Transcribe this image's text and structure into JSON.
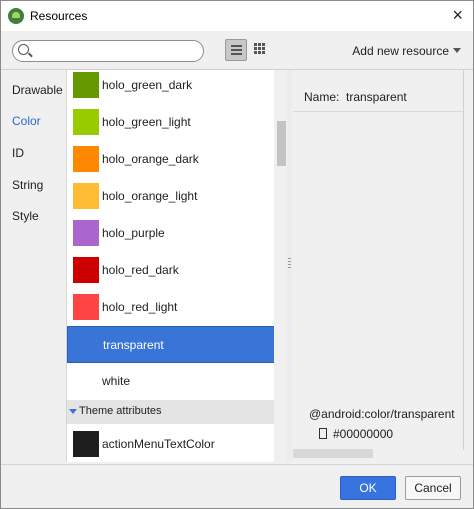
{
  "window": {
    "title": "Resources",
    "close_glyph": "×"
  },
  "search": {
    "value": "",
    "placeholder": ""
  },
  "toolbar": {
    "add_new_label": "Add new resource"
  },
  "left_nav": {
    "items": [
      {
        "label": "Drawable",
        "active": false
      },
      {
        "label": "Color",
        "active": true
      },
      {
        "label": "ID",
        "active": false
      },
      {
        "label": "String",
        "active": false
      },
      {
        "label": "Style",
        "active": false
      }
    ]
  },
  "resources": [
    {
      "label": "holo_green_dark",
      "color": "#669900"
    },
    {
      "label": "holo_green_light",
      "color": "#99cc00"
    },
    {
      "label": "holo_orange_dark",
      "color": "#ff8800"
    },
    {
      "label": "holo_orange_light",
      "color": "#ffbb33"
    },
    {
      "label": "holo_purple",
      "color": "#aa66cc"
    },
    {
      "label": "holo_red_dark",
      "color": "#cc0000"
    },
    {
      "label": "holo_red_light",
      "color": "#ff4444"
    },
    {
      "label": "transparent",
      "color": "#00000000",
      "selected": true
    },
    {
      "label": "white",
      "color": "#ffffff"
    }
  ],
  "theme_section": {
    "label": "Theme attributes",
    "items": [
      {
        "label": "actionMenuTextColor",
        "color": "#1e1e1e"
      }
    ]
  },
  "detail": {
    "name_label": "Name:",
    "name_value": "transparent",
    "resource_ref": "@android:color/transparent",
    "resource_value": "#00000000"
  },
  "footer": {
    "ok_label": "OK",
    "cancel_label": "Cancel"
  },
  "colors": {
    "accent": "#3875d7",
    "ok_button": "#3874e0"
  }
}
